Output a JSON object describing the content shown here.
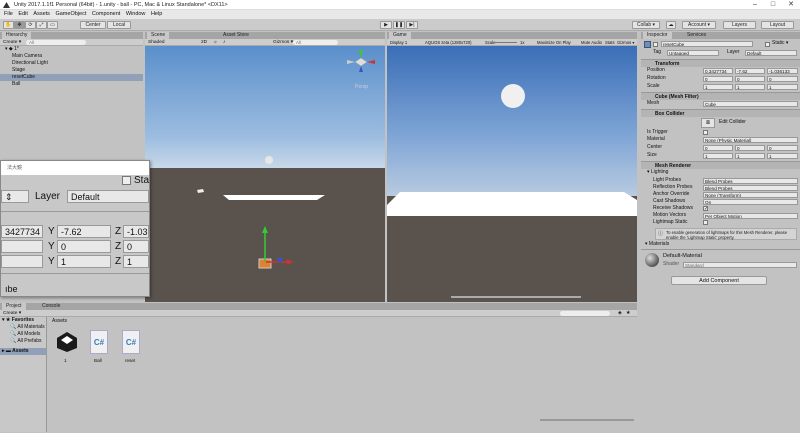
{
  "window": {
    "title": "Unity 2017.1.1f1 Personal (64bit) - 1.unity - ball - PC, Mac & Linux Standalone* <DX11>"
  },
  "menu": [
    "File",
    "Edit",
    "Assets",
    "GameObject",
    "Component",
    "Window",
    "Help"
  ],
  "toolbar": {
    "center_label": "Center",
    "local_label": "Local",
    "collab_label": "Collab ▾",
    "account_label": "Account ▾",
    "layers_label": "Layers",
    "layout_label": "Layout"
  },
  "hierarchy": {
    "tab": "Hierarchy",
    "create_label": "Create ▾",
    "search_placeholder": "All",
    "scene": "1*",
    "items": [
      {
        "label": "Main Camera"
      },
      {
        "label": "Directional Light"
      },
      {
        "label": "Stage"
      },
      {
        "label": "resetCube"
      },
      {
        "label": "Ball"
      }
    ]
  },
  "scene": {
    "tab": "Scene",
    "asset_store_tab": "Asset Store",
    "shading": "Shaded",
    "mode_2d": "2D",
    "gizmos": "Gizmos ▾",
    "search": "All",
    "persp": "Persp"
  },
  "game": {
    "tab": "Game",
    "display": "Display 1",
    "resolution": "AQUOS zeta (1280x720)",
    "scale_label": "Scale",
    "scale_value": "1x",
    "maximize": "Maximize On Play",
    "mute": "Mute Audio",
    "stats": "Stats",
    "gizmos": "Gizmos ▾"
  },
  "inspector": {
    "tabs": [
      "Inspector",
      "Services"
    ],
    "object_name": "resetCube",
    "static_label": "Static ▾",
    "tag_label": "Tag",
    "tag_value": "Untagged",
    "layer_label": "Layer",
    "layer_value": "Default",
    "transform": {
      "title": "Transform",
      "position_label": "Position",
      "rotation_label": "Rotation",
      "scale_label": "Scale",
      "position": {
        "x": "0.3427734",
        "y": "-7.62",
        "z": "-1.036133"
      },
      "rotation": {
        "x": "0",
        "y": "0",
        "z": "0"
      },
      "scale": {
        "x": "1",
        "y": "1",
        "z": "1"
      }
    },
    "mesh_filter": {
      "title": "Cube (Mesh Filter)",
      "mesh_label": "Mesh",
      "mesh_value": "Cube"
    },
    "box_collider": {
      "title": "Box Collider",
      "edit_label": "Edit Collider",
      "trigger_label": "Is Trigger",
      "material_label": "Material",
      "material_value": "None (Physic Material)",
      "center_label": "Center",
      "size_label": "Size",
      "center": {
        "x": "0",
        "y": "0",
        "z": "0"
      },
      "size": {
        "x": "1",
        "y": "1",
        "z": "1"
      }
    },
    "mesh_renderer": {
      "title": "Mesh Renderer",
      "lighting_label": "Lighting",
      "rows": [
        {
          "label": "Light Probes",
          "value": "Blend Probes"
        },
        {
          "label": "Reflection Probes",
          "value": "Blend Probes"
        },
        {
          "label": "Anchor Override",
          "value": "None (Transform)"
        },
        {
          "label": "Cast Shadows",
          "value": "On"
        },
        {
          "label": "Receive Shadows",
          "value": ""
        },
        {
          "label": "Motion Vectors",
          "value": "Per Object Motion"
        },
        {
          "label": "Lightmap Static",
          "value": ""
        }
      ],
      "info": "To enable generation of lightmaps for this Mesh Renderer, please enable the 'Lightmap Static' property."
    },
    "materials_label": "Materials",
    "material": {
      "name": "Default-Material",
      "shader_label": "Shader",
      "shader_value": "Standard"
    },
    "add_component": "Add Component"
  },
  "popup": {
    "title": "法大鏡",
    "static": "Sta",
    "layer_label": "Layer",
    "layer_value": "Default",
    "pos_x": "3427734",
    "pos_y": "-7.62",
    "pos_z": "-1.03",
    "rot_y": "0",
    "rot_z": "0",
    "scale_y": "1",
    "scale_z": "1",
    "bottom": "ıbe"
  },
  "project": {
    "tabs": [
      "Project",
      "Console"
    ],
    "create_label": "Create ▾",
    "favorites_label": "Favorites",
    "favorites": [
      "All Materials",
      "All Models",
      "All Prefabs"
    ],
    "assets_label": "Assets",
    "breadcrumb": "Assets",
    "files": [
      {
        "name": "1",
        "icon": "unity-scene-icon"
      },
      {
        "name": "Ball",
        "icon": "csharp-script-icon"
      },
      {
        "name": "reset",
        "icon": "csharp-script-icon"
      }
    ]
  }
}
